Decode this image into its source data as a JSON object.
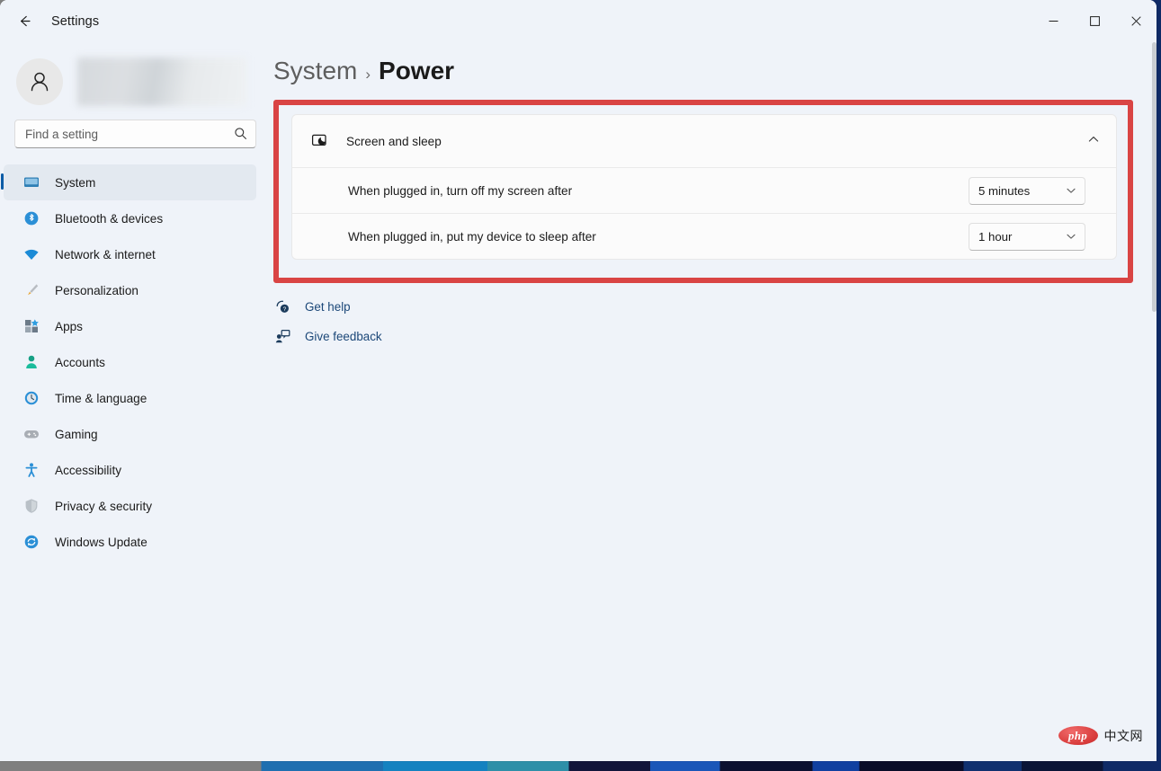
{
  "window": {
    "app_title": "Settings",
    "back_icon": "arrow-left-icon",
    "caption": {
      "minimize_label": "─",
      "maximize_label": "□",
      "close_label": "✕"
    }
  },
  "account": {
    "avatar_icon": "person-avatar-icon",
    "name": ""
  },
  "search": {
    "placeholder": "Find a setting",
    "value": "",
    "icon": "search-icon"
  },
  "sidebar": {
    "items": [
      {
        "label": "System",
        "icon": "monitor-icon",
        "active": true
      },
      {
        "label": "Bluetooth & devices",
        "icon": "bluetooth-icon",
        "active": false
      },
      {
        "label": "Network & internet",
        "icon": "wifi-icon",
        "active": false
      },
      {
        "label": "Personalization",
        "icon": "paintbrush-icon",
        "active": false
      },
      {
        "label": "Apps",
        "icon": "apps-grid-icon",
        "active": false
      },
      {
        "label": "Accounts",
        "icon": "person-icon",
        "active": false
      },
      {
        "label": "Time & language",
        "icon": "clock-globe-icon",
        "active": false
      },
      {
        "label": "Gaming",
        "icon": "gamepad-icon",
        "active": false
      },
      {
        "label": "Accessibility",
        "icon": "accessibility-icon",
        "active": false
      },
      {
        "label": "Privacy & security",
        "icon": "shield-icon",
        "active": false
      },
      {
        "label": "Windows Update",
        "icon": "refresh-icon",
        "active": false
      }
    ]
  },
  "breadcrumb": {
    "parent": "System",
    "separator": "›",
    "current": "Power"
  },
  "main": {
    "highlight_color": "#d94444",
    "card": {
      "title": "Screen and sleep",
      "icon": "screen-sleep-icon",
      "expanded": true,
      "collapse_icon": "chevron-up-icon",
      "rows": [
        {
          "label": "When plugged in, turn off my screen after",
          "value": "5 minutes",
          "chevron": "chevron-down-icon"
        },
        {
          "label": "When plugged in, put my device to sleep after",
          "value": "1 hour",
          "chevron": "chevron-down-icon"
        }
      ]
    },
    "links": [
      {
        "label": "Get help",
        "icon": "help-icon"
      },
      {
        "label": "Give feedback",
        "icon": "feedback-icon"
      }
    ]
  },
  "watermark": {
    "logo_text": "php",
    "site_text": "中文网"
  }
}
